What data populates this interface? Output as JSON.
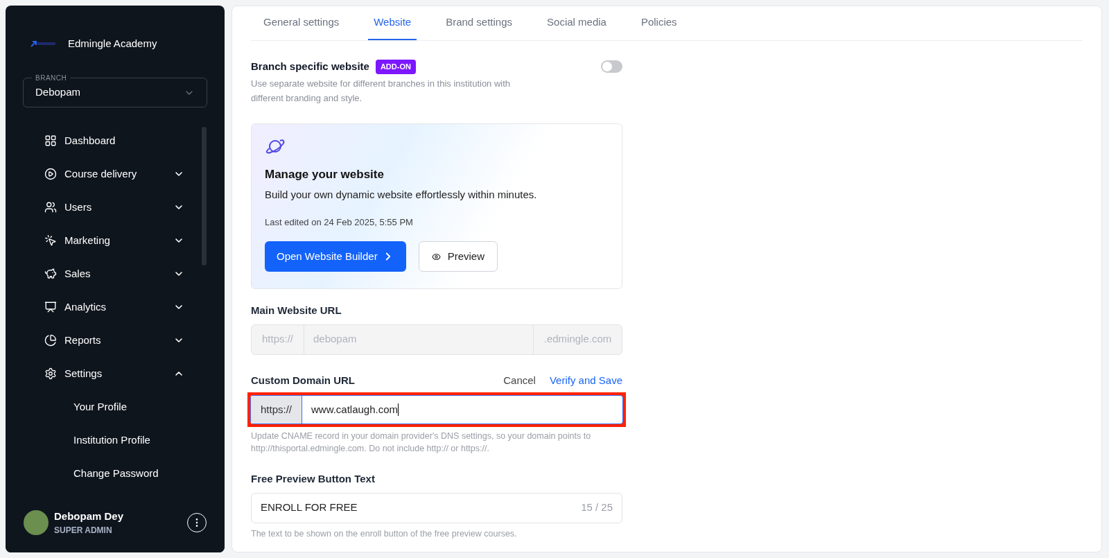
{
  "sidebar": {
    "brand": "Edmingle Academy",
    "branch": {
      "label": "BRANCH",
      "value": "Debopam"
    },
    "items": [
      {
        "label": "Dashboard",
        "kind": "link"
      },
      {
        "label": "Course delivery",
        "kind": "group",
        "expanded": false
      },
      {
        "label": "Users",
        "kind": "group",
        "expanded": false
      },
      {
        "label": "Marketing",
        "kind": "group",
        "expanded": false
      },
      {
        "label": "Sales",
        "kind": "group",
        "expanded": false
      },
      {
        "label": "Analytics",
        "kind": "group",
        "expanded": false
      },
      {
        "label": "Reports",
        "kind": "group",
        "expanded": false
      },
      {
        "label": "Settings",
        "kind": "group",
        "expanded": true,
        "children": [
          {
            "label": "Your Profile"
          },
          {
            "label": "Institution Profile"
          },
          {
            "label": "Change Password"
          }
        ]
      }
    ],
    "user": {
      "name": "Debopam Dey",
      "role": "SUPER ADMIN"
    }
  },
  "tabs": [
    {
      "label": "General settings",
      "selected": false
    },
    {
      "label": "Website",
      "selected": true
    },
    {
      "label": "Brand settings",
      "selected": false
    },
    {
      "label": "Social media",
      "selected": false
    },
    {
      "label": "Policies",
      "selected": false
    }
  ],
  "branch_website": {
    "title": "Branch specific website",
    "badge": "ADD-ON",
    "description": "Use separate website for different branches in this institution with different branding and style.",
    "on": false
  },
  "website_card": {
    "title": "Manage your website",
    "subtitle": "Build your own dynamic website effortlessly within minutes.",
    "last_edited": "Last edited on 24 Feb 2025, 5:55 PM",
    "primary_button": "Open Website Builder",
    "secondary_button": "Preview"
  },
  "main_url": {
    "label": "Main Website URL",
    "prefix": "https://",
    "value": "debopam",
    "suffix": ".edmingle.com",
    "disabled": true
  },
  "custom_domain": {
    "label": "Custom Domain URL",
    "cancel": "Cancel",
    "save": "Verify and Save",
    "prefix": "https://",
    "value": "www.catlaugh.com",
    "highlighted": true,
    "help": "Update CNAME record in your domain provider's DNS settings, so your domain points to http://thisportal.edmingle.com. Do not include http:// or https://."
  },
  "free_preview": {
    "label": "Free Preview Button Text",
    "value": "ENROLL FOR FREE",
    "counter": "15 / 25",
    "help": "The text to be shown on the enroll button of the free preview courses."
  }
}
